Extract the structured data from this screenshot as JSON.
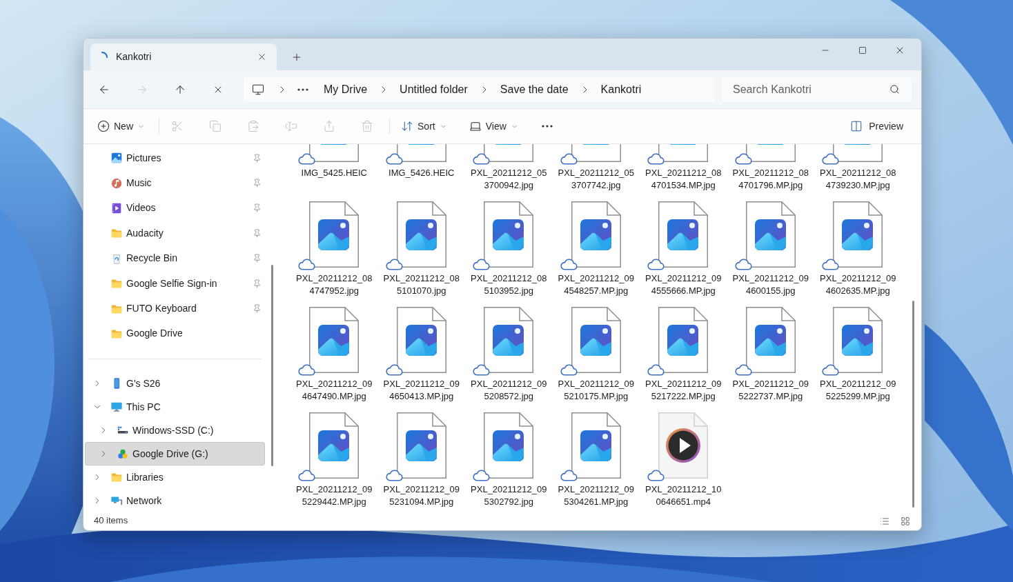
{
  "tabs": [
    {
      "label": "Kankotri",
      "selected": true,
      "loading": true
    }
  ],
  "nav_buttons": [
    {
      "kind": "back",
      "disabled": false
    },
    {
      "kind": "forward",
      "disabled": true
    },
    {
      "kind": "up",
      "disabled": false
    },
    {
      "kind": "stop",
      "disabled": false
    }
  ],
  "address_bar": {
    "breadcrumb": [
      "My Drive",
      "Untitled folder",
      "Save the date",
      "Kankotri"
    ]
  },
  "search": {
    "placeholder": "Search Kankotri"
  },
  "toolbar": {
    "items": [
      {
        "kind": "new",
        "label": "New",
        "dropdown": true,
        "disabled": false
      },
      {
        "kind": "cut",
        "disabled": true
      },
      {
        "kind": "copy",
        "disabled": true
      },
      {
        "kind": "paste",
        "disabled": true
      },
      {
        "kind": "rename",
        "disabled": true
      },
      {
        "kind": "share",
        "disabled": true
      },
      {
        "kind": "delete",
        "disabled": true
      },
      {
        "kind": "sort",
        "label": "Sort",
        "dropdown": true,
        "disabled": false
      },
      {
        "kind": "view",
        "label": "View",
        "dropdown": true,
        "disabled": false
      },
      {
        "kind": "more",
        "disabled": false
      }
    ],
    "preview": {
      "label": "Preview"
    }
  },
  "sidebar": {
    "quick_access": [
      {
        "label": "Pictures",
        "kind": "pictures",
        "pinned": true,
        "selected": false
      },
      {
        "label": "Music",
        "kind": "music",
        "pinned": true,
        "selected": false
      },
      {
        "label": "Videos",
        "kind": "videos",
        "pinned": true,
        "selected": false
      },
      {
        "label": "Audacity",
        "kind": "folder",
        "pinned": true,
        "selected": false
      },
      {
        "label": "Recycle Bin",
        "kind": "recycle",
        "pinned": true,
        "selected": false
      },
      {
        "label": "Google Selfie Sign-in",
        "kind": "folder",
        "pinned": true,
        "selected": false
      },
      {
        "label": "FUTO Keyboard",
        "kind": "folder",
        "pinned": true,
        "selected": false
      },
      {
        "label": "Google Drive",
        "kind": "folder",
        "pinned": false,
        "selected": false
      }
    ],
    "tree": [
      {
        "label": "G's S26",
        "kind": "phone",
        "expanded": false,
        "selected": false
      },
      {
        "label": "This PC",
        "kind": "pc",
        "expanded": true,
        "selected": false,
        "children": [
          {
            "label": "Windows-SSD (C:)",
            "kind": "disk",
            "expanded": false,
            "selected": false
          },
          {
            "label": "Google Drive (G:)",
            "kind": "cloud",
            "expanded": false,
            "selected": true
          }
        ]
      },
      {
        "label": "Libraries",
        "kind": "library",
        "expanded": false,
        "selected": false
      },
      {
        "label": "Network",
        "kind": "network",
        "expanded": false,
        "selected": false
      }
    ]
  },
  "files": [
    {
      "name_lines": [
        "IMG_5425.HEIC"
      ],
      "kind": "image",
      "cloud": true
    },
    {
      "name_lines": [
        "IMG_5426.HEIC"
      ],
      "kind": "image",
      "cloud": true
    },
    {
      "name_lines": [
        "PXL_20211212_05",
        "3700942.jpg"
      ],
      "kind": "image",
      "cloud": true
    },
    {
      "name_lines": [
        "PXL_20211212_05",
        "3707742.jpg"
      ],
      "kind": "image",
      "cloud": true
    },
    {
      "name_lines": [
        "PXL_20211212_08",
        "4701534.MP.jpg"
      ],
      "kind": "image",
      "cloud": true
    },
    {
      "name_lines": [
        "PXL_20211212_08",
        "4701796.MP.jpg"
      ],
      "kind": "image",
      "cloud": true
    },
    {
      "name_lines": [
        "PXL_20211212_08",
        "4739230.MP.jpg"
      ],
      "kind": "image",
      "cloud": true
    },
    {
      "name_lines": [
        "PXL_20211212_08",
        "4747952.jpg"
      ],
      "kind": "image",
      "cloud": true
    },
    {
      "name_lines": [
        "PXL_20211212_08",
        "5101070.jpg"
      ],
      "kind": "image",
      "cloud": true
    },
    {
      "name_lines": [
        "PXL_20211212_08",
        "5103952.jpg"
      ],
      "kind": "image",
      "cloud": true
    },
    {
      "name_lines": [
        "PXL_20211212_09",
        "4548257.MP.jpg"
      ],
      "kind": "image",
      "cloud": true
    },
    {
      "name_lines": [
        "PXL_20211212_09",
        "4555666.MP.jpg"
      ],
      "kind": "image",
      "cloud": true
    },
    {
      "name_lines": [
        "PXL_20211212_09",
        "4600155.jpg"
      ],
      "kind": "image",
      "cloud": true
    },
    {
      "name_lines": [
        "PXL_20211212_09",
        "4602635.MP.jpg"
      ],
      "kind": "image",
      "cloud": true
    },
    {
      "name_lines": [
        "PXL_20211212_09",
        "4647490.MP.jpg"
      ],
      "kind": "image",
      "cloud": true
    },
    {
      "name_lines": [
        "PXL_20211212_09",
        "4650413.MP.jpg"
      ],
      "kind": "image",
      "cloud": true
    },
    {
      "name_lines": [
        "PXL_20211212_09",
        "5208572.jpg"
      ],
      "kind": "image",
      "cloud": true
    },
    {
      "name_lines": [
        "PXL_20211212_09",
        "5210175.MP.jpg"
      ],
      "kind": "image",
      "cloud": true
    },
    {
      "name_lines": [
        "PXL_20211212_09",
        "5217222.MP.jpg"
      ],
      "kind": "image",
      "cloud": true
    },
    {
      "name_lines": [
        "PXL_20211212_09",
        "5222737.MP.jpg"
      ],
      "kind": "image",
      "cloud": true
    },
    {
      "name_lines": [
        "PXL_20211212_09",
        "5225299.MP.jpg"
      ],
      "kind": "image",
      "cloud": true
    },
    {
      "name_lines": [
        "PXL_20211212_09",
        "5229442.MP.jpg"
      ],
      "kind": "image",
      "cloud": true
    },
    {
      "name_lines": [
        "PXL_20211212_09",
        "5231094.MP.jpg"
      ],
      "kind": "image",
      "cloud": true
    },
    {
      "name_lines": [
        "PXL_20211212_09",
        "5302792.jpg"
      ],
      "kind": "image",
      "cloud": true
    },
    {
      "name_lines": [
        "PXL_20211212_09",
        "5304261.MP.jpg"
      ],
      "kind": "image",
      "cloud": true
    },
    {
      "name_lines": [
        "PXL_20211212_10",
        "0646651.mp4"
      ],
      "kind": "video",
      "cloud": true
    }
  ],
  "status_bar": {
    "item_count": "40 items"
  }
}
